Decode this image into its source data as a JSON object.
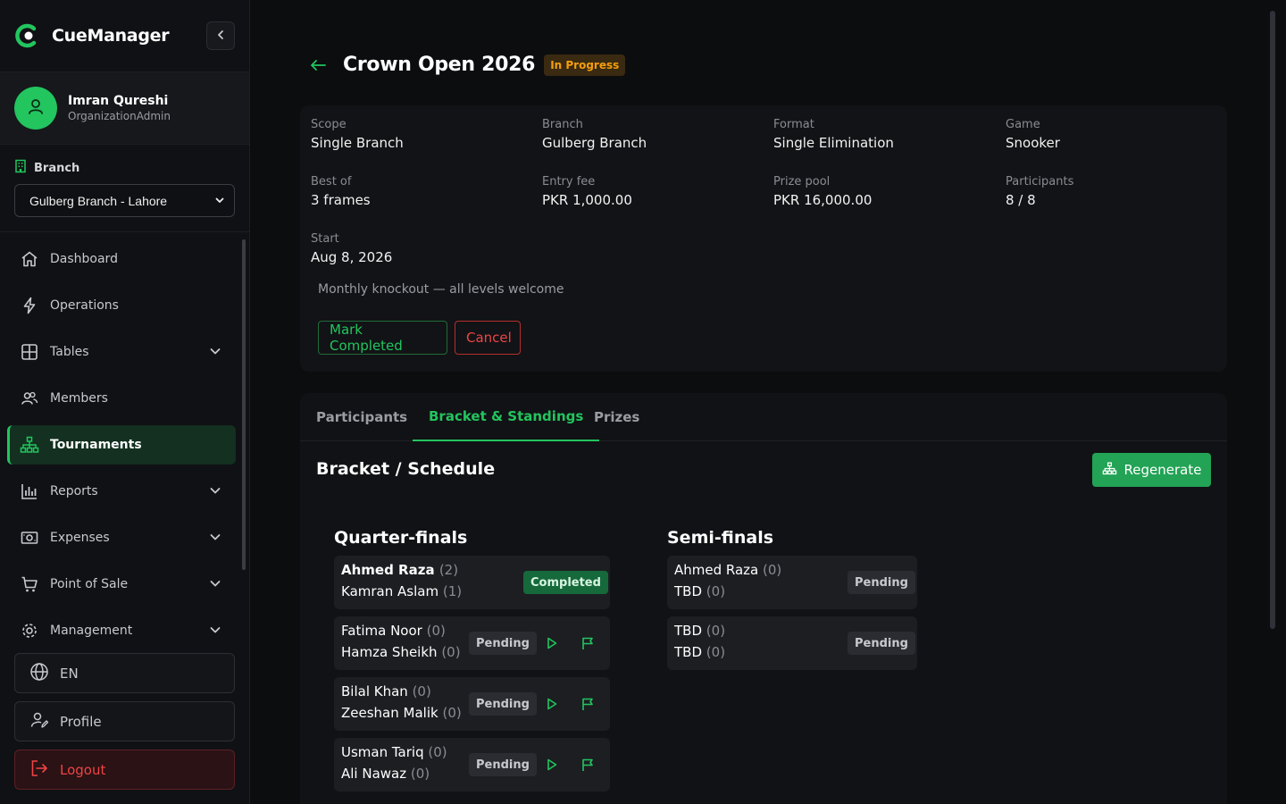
{
  "brand": {
    "name": "CueManager"
  },
  "user": {
    "name": "Imran Qureshi",
    "role": "OrganizationAdmin"
  },
  "branch": {
    "label": "Branch",
    "selected": "Gulberg Branch - Lahore"
  },
  "nav": [
    {
      "label": "Dashboard",
      "icon": "home-icon"
    },
    {
      "label": "Operations",
      "icon": "bolt-icon"
    },
    {
      "label": "Tables",
      "icon": "grid-icon"
    },
    {
      "label": "Members",
      "icon": "users-icon"
    },
    {
      "label": "Tournaments",
      "icon": "sitemap-icon"
    },
    {
      "label": "Reports",
      "icon": "bar-chart-icon"
    },
    {
      "label": "Expenses",
      "icon": "cash-icon"
    },
    {
      "label": "Point of Sale",
      "icon": "cart-icon"
    },
    {
      "label": "Management",
      "icon": "gear-icon"
    }
  ],
  "bottom": {
    "language": "EN",
    "profile": "Profile",
    "logout": "Logout"
  },
  "header": {
    "title": "Crown Open 2026",
    "status": "In Progress"
  },
  "details": {
    "scope": {
      "k": "Scope",
      "v": "Single Branch"
    },
    "branch": {
      "k": "Branch",
      "v": "Gulberg Branch"
    },
    "format": {
      "k": "Format",
      "v": "Single Elimination"
    },
    "game": {
      "k": "Game",
      "v": "Snooker"
    },
    "best_of": {
      "k": "Best of",
      "v": "3 frames"
    },
    "entry_fee": {
      "k": "Entry fee",
      "v": "PKR 1,000.00"
    },
    "prize_pool": {
      "k": "Prize pool",
      "v": "PKR 16,000.00"
    },
    "participants": {
      "k": "Participants",
      "v": "8 / 8"
    },
    "start": {
      "k": "Start",
      "v": "Aug 8, 2026"
    },
    "description": "Monthly knockout — all levels welcome"
  },
  "actions": {
    "complete": "Mark Completed",
    "cancel": "Cancel"
  },
  "tabs": [
    "Participants",
    "Bracket & Standings",
    "Prizes"
  ],
  "bracket": {
    "title": "Bracket / Schedule",
    "regenerate": "Regenerate",
    "rounds": [
      {
        "name": "Quarter-finals",
        "matches": [
          {
            "p1": "Ahmed Raza",
            "s1": "(2)",
            "p2": "Kamran Aslam",
            "s2": "(1)",
            "status": "Completed"
          },
          {
            "p1": "Fatima Noor",
            "s1": "(0)",
            "p2": "Hamza Sheikh",
            "s2": "(0)",
            "status": "Pending"
          },
          {
            "p1": "Bilal Khan",
            "s1": "(0)",
            "p2": "Zeeshan Malik",
            "s2": "(0)",
            "status": "Pending"
          },
          {
            "p1": "Usman Tariq",
            "s1": "(0)",
            "p2": "Ali Nawaz",
            "s2": "(0)",
            "status": "Pending"
          }
        ]
      },
      {
        "name": "Semi-finals",
        "matches": [
          {
            "p1": "Ahmed Raza",
            "s1": "(0)",
            "p2": "TBD",
            "s2": "(0)",
            "status": "Pending"
          },
          {
            "p1": "TBD",
            "s1": "(0)",
            "p2": "TBD",
            "s2": "(0)",
            "status": "Pending"
          }
        ]
      }
    ]
  },
  "colors": {
    "accent": "#22c55e",
    "danger": "#ef4444",
    "warning": "#f59e0b",
    "bg": "#0c0d0f"
  }
}
